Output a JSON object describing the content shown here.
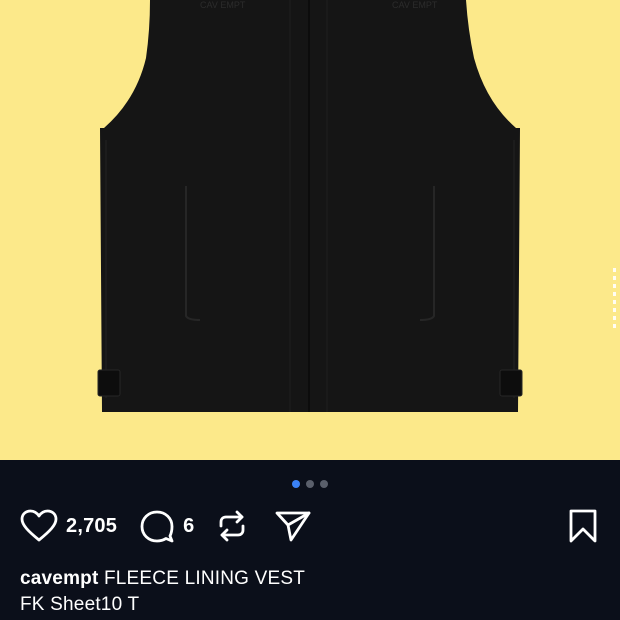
{
  "media": {
    "background_color": "#fce98a",
    "garment_color": "#151515",
    "chest_text": "CAV EMPT"
  },
  "carousel": {
    "total": 3,
    "active_index": 0,
    "active_color": "#3b82f6",
    "inactive_color": "#5a5f6b"
  },
  "actions": {
    "like_icon": "heart-icon",
    "like_count": "2,705",
    "comment_icon": "comment-icon",
    "comment_count": "6",
    "repost_icon": "repost-icon",
    "share_icon": "send-icon",
    "save_icon": "bookmark-icon"
  },
  "caption": {
    "username": "cavempt",
    "line1_text": "FLEECE LINING VEST",
    "line2_text": "FK Sheet10 T"
  }
}
